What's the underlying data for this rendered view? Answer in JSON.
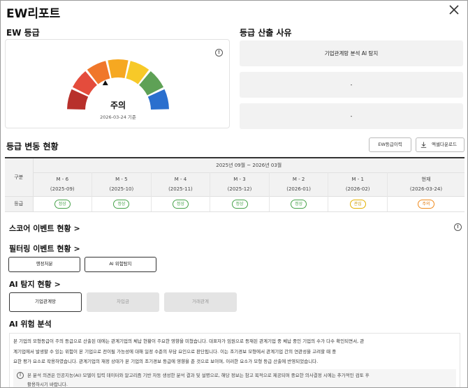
{
  "window": {
    "title": "EW리포트"
  },
  "ew_grade": {
    "section_title": "EW 등급",
    "grade": "주의",
    "date": "2026-03-24 기준",
    "gauge_colors": [
      "#b8302b",
      "#e44c3c",
      "#f0772a",
      "#f6a821",
      "#f7c928",
      "#5ea156",
      "#2a6fce"
    ],
    "grade_index": 2
  },
  "grade_reason": {
    "section_title": "등급 산출 사유",
    "items": [
      "기업관계망 분석 AI 탐지",
      "-",
      "-"
    ]
  },
  "grade_history": {
    "section_title": "등급 변동 현황",
    "ew_history_button": "EW등급이력",
    "excel_button": "엑셀다운로드",
    "period": "2025년 09월 ~ 2026년 03월",
    "row_header_gubun": "구분",
    "row_header_grade": "등급",
    "columns": [
      {
        "label": "M - 6",
        "sub": "(2025-09)",
        "grade": "정상",
        "level": "normal"
      },
      {
        "label": "M - 5",
        "sub": "(2025-10)",
        "grade": "정상",
        "level": "normal"
      },
      {
        "label": "M - 4",
        "sub": "(2025-11)",
        "grade": "정상",
        "level": "normal"
      },
      {
        "label": "M - 3",
        "sub": "(2025-12)",
        "grade": "정상",
        "level": "normal"
      },
      {
        "label": "M - 2",
        "sub": "(2026-01)",
        "grade": "정상",
        "level": "normal"
      },
      {
        "label": "M - 1",
        "sub": "(2026-02)",
        "grade": "관심",
        "level": "watch"
      },
      {
        "label": "현재",
        "sub": "(2026-03-24)",
        "grade": "주의",
        "level": "caution"
      }
    ]
  },
  "score_events": {
    "title": "스코어 이벤트 현황 >"
  },
  "filtering_events": {
    "title": "필터링 이벤트 현황 >",
    "buttons": [
      "행정처분",
      "AI 위험탐지"
    ]
  },
  "ai_detection": {
    "title": "AI 탐지 현황 >",
    "tabs": [
      "기업관계망",
      "차입금",
      "거래관계"
    ]
  },
  "ai_analysis": {
    "title": "AI 위험 분석",
    "lines": [
      "본 기업의 모형등급이 주의 등급으로 산출된 데에는 관계기업의 체납 현황이 주요한 영향을 미쳤습니다. 대표자가 임원으로 등재된 관계기업 중 체납 중인 기업의 수가 다수 확인되면서, 관",
      "계기업에서 발생할 수 있는 위험이 본 기업으로 전이될 가능성에 대해 일정 수준의 부담 요인으로 판단됩니다. 이는 조기경보 모형에서 관계기업 간의 연관성을 고려할 때 중",
      "요한 평가 요소로 작용하였습니다. 관계기업의 재정 상태가 본 기업의 조기경보 등급에 영향을 준 것으로 보이며, 이러한 요소가 모형 등급 산출에 반영되었습니다."
    ],
    "notice_lines": [
      "본 분석 의견은 인공지능(AI) 모델이 입력 데이터와 알고리즘 기반 자동 생성한 분석 결과 및 설명으로, 해당 정보는 참고 목적으로 제공되며 중요한 의사결정 시에는 추가적인 검토 후",
      "활용하시기 바랍니다."
    ]
  }
}
